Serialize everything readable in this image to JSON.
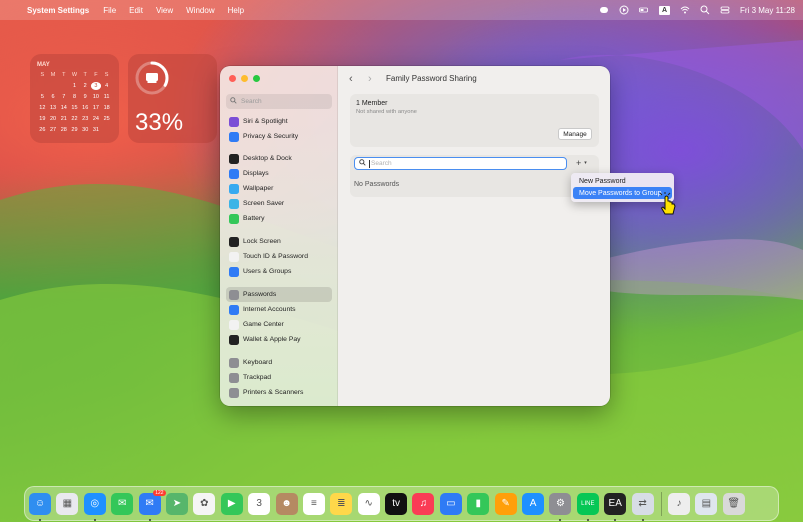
{
  "menubar": {
    "app_name": "System Settings",
    "items": [
      "File",
      "Edit",
      "View",
      "Window",
      "Help"
    ],
    "datetime": "Fri 3 May  11:28",
    "input_indicator": "A"
  },
  "widgets": {
    "calendar": {
      "month": "MAY",
      "dow": [
        "S",
        "M",
        "T",
        "W",
        "T",
        "F",
        "S"
      ],
      "days": [
        "",
        "",
        "",
        "1",
        "2",
        "3",
        "4",
        "5",
        "6",
        "7",
        "8",
        "9",
        "10",
        "11",
        "12",
        "13",
        "14",
        "15",
        "16",
        "17",
        "18",
        "19",
        "20",
        "21",
        "22",
        "23",
        "24",
        "25",
        "26",
        "27",
        "28",
        "29",
        "30",
        "31",
        ""
      ],
      "today": "3"
    },
    "battery": {
      "percent_label": "33%",
      "level": 0.33
    }
  },
  "window": {
    "title": "Family Password Sharing",
    "sidebar": {
      "search_placeholder": "Search",
      "items": [
        {
          "label": "Siri & Spotlight",
          "icon": "siri-icon",
          "color": "#7b4ed6"
        },
        {
          "label": "Privacy & Security",
          "icon": "hand-icon",
          "color": "#2f7bf5"
        },
        {
          "label": "Desktop & Dock",
          "icon": "dock-icon",
          "color": "#222222"
        },
        {
          "label": "Displays",
          "icon": "sun-icon",
          "color": "#2f7bf5"
        },
        {
          "label": "Wallpaper",
          "icon": "flower-icon",
          "color": "#37aaf0"
        },
        {
          "label": "Screen Saver",
          "icon": "screensaver-icon",
          "color": "#3cb4e6"
        },
        {
          "label": "Battery",
          "icon": "battery-icon",
          "color": "#34c759"
        },
        {
          "label": "Lock Screen",
          "icon": "lock-icon",
          "color": "#222222"
        },
        {
          "label": "Touch ID & Password",
          "icon": "fingerprint-icon",
          "color": "#f2f2f2"
        },
        {
          "label": "Users & Groups",
          "icon": "users-icon",
          "color": "#2f7bf5"
        },
        {
          "label": "Passwords",
          "icon": "key-icon",
          "color": "#8e8e93"
        },
        {
          "label": "Internet Accounts",
          "icon": "at-icon",
          "color": "#2f7bf5"
        },
        {
          "label": "Game Center",
          "icon": "gamecenter-icon",
          "color": "#f2f2f2"
        },
        {
          "label": "Wallet & Apple Pay",
          "icon": "wallet-icon",
          "color": "#222222"
        },
        {
          "label": "Keyboard",
          "icon": "keyboard-icon",
          "color": "#8e8e93"
        },
        {
          "label": "Trackpad",
          "icon": "trackpad-icon",
          "color": "#8e8e93"
        },
        {
          "label": "Printers & Scanners",
          "icon": "printer-icon",
          "color": "#8e8e93"
        }
      ],
      "selected": "Passwords"
    },
    "content": {
      "member_count": "1 Member",
      "member_sub": "Not shared with anyone",
      "manage_label": "Manage",
      "search_placeholder": "Search",
      "add_label": "+",
      "empty_label": "No Passwords"
    }
  },
  "dropdown": {
    "options": [
      "New Password",
      "Move Passwords to Group"
    ],
    "highlighted": "Move Passwords to Group"
  },
  "dock": {
    "apps": [
      {
        "name": "finder-icon",
        "color": "#2f8ef0",
        "glyph": "☺",
        "running": true
      },
      {
        "name": "launchpad-icon",
        "color": "#e9e9ee",
        "glyph": "▦",
        "running": false
      },
      {
        "name": "safari-icon",
        "color": "#1e90ff",
        "glyph": "◎",
        "running": true
      },
      {
        "name": "messages-icon",
        "color": "#34c759",
        "glyph": "✉",
        "running": false
      },
      {
        "name": "mail-icon",
        "color": "#2f7bf5",
        "glyph": "✉",
        "running": true,
        "badge": "122"
      },
      {
        "name": "maps-icon",
        "color": "#57b66b",
        "glyph": "➤",
        "running": false
      },
      {
        "name": "photos-icon",
        "color": "#f5f5f5",
        "glyph": "✿",
        "running": false
      },
      {
        "name": "facetime-icon",
        "color": "#34c759",
        "glyph": "▶",
        "running": false
      },
      {
        "name": "calendar-icon",
        "color": "#ffffff",
        "glyph": "3",
        "running": false
      },
      {
        "name": "contacts-icon",
        "color": "#b58a62",
        "glyph": "☻",
        "running": false
      },
      {
        "name": "reminders-icon",
        "color": "#ffffff",
        "glyph": "≡",
        "running": false
      },
      {
        "name": "notes-icon",
        "color": "#ffd84a",
        "glyph": "≣",
        "running": false
      },
      {
        "name": "freeform-icon",
        "color": "#ffffff",
        "glyph": "∿",
        "running": false
      },
      {
        "name": "appletv-icon",
        "color": "#111111",
        "glyph": "tv",
        "running": false
      },
      {
        "name": "music-icon",
        "color": "#fa3c55",
        "glyph": "♫",
        "running": false
      },
      {
        "name": "keynote-icon",
        "color": "#2f7bf5",
        "glyph": "▭",
        "running": false
      },
      {
        "name": "numbers-icon",
        "color": "#34c759",
        "glyph": "▮",
        "running": false
      },
      {
        "name": "pages-icon",
        "color": "#ff9f0a",
        "glyph": "✎",
        "running": false
      },
      {
        "name": "appstore-icon",
        "color": "#1e90ff",
        "glyph": "A",
        "running": false
      },
      {
        "name": "system-settings-icon",
        "color": "#8e8e93",
        "glyph": "⚙",
        "running": true
      },
      {
        "name": "line-icon",
        "color": "#06c755",
        "glyph": "LINE",
        "running": true
      },
      {
        "name": "ea-icon",
        "color": "#222222",
        "glyph": "EA",
        "running": true
      },
      {
        "name": "migration-icon",
        "color": "#d7dde6",
        "glyph": "⇄",
        "running": true
      },
      {
        "name": "audio-file-icon",
        "color": "#eeeeee",
        "glyph": "♪",
        "running": false,
        "after_sep": true
      },
      {
        "name": "screenshot-file-icon",
        "color": "#dfe6ee",
        "glyph": "▤",
        "running": false
      },
      {
        "name": "trash-icon",
        "color": "#d9d9d9",
        "glyph": "🗑",
        "running": false
      }
    ]
  }
}
